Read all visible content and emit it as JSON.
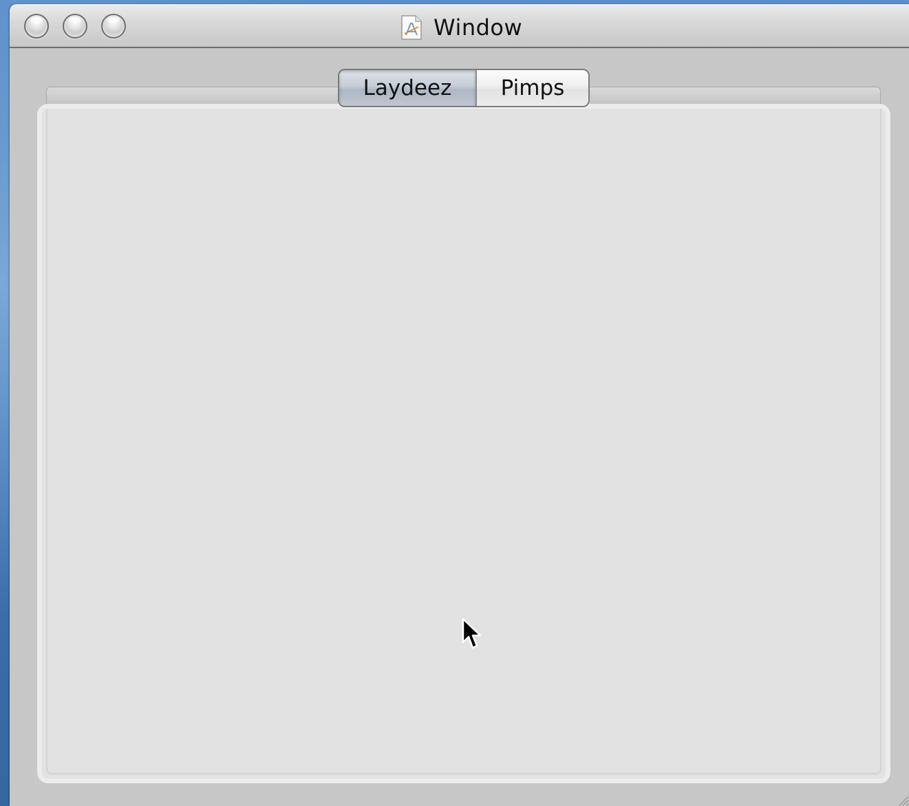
{
  "window": {
    "title": "Window",
    "title_icon": "app-document-icon",
    "buttons": {
      "close": "close-button",
      "minimize": "minimize-button",
      "zoom": "zoom-button"
    }
  },
  "tabs": {
    "items": [
      {
        "label": "Laydeez",
        "selected": true
      },
      {
        "label": "Pimps",
        "selected": false
      }
    ]
  },
  "colors": {
    "window_bg": "#c7c7c7",
    "tab_content_bg": "#e2e2e2",
    "desktop_bg": "#3f73b3"
  }
}
